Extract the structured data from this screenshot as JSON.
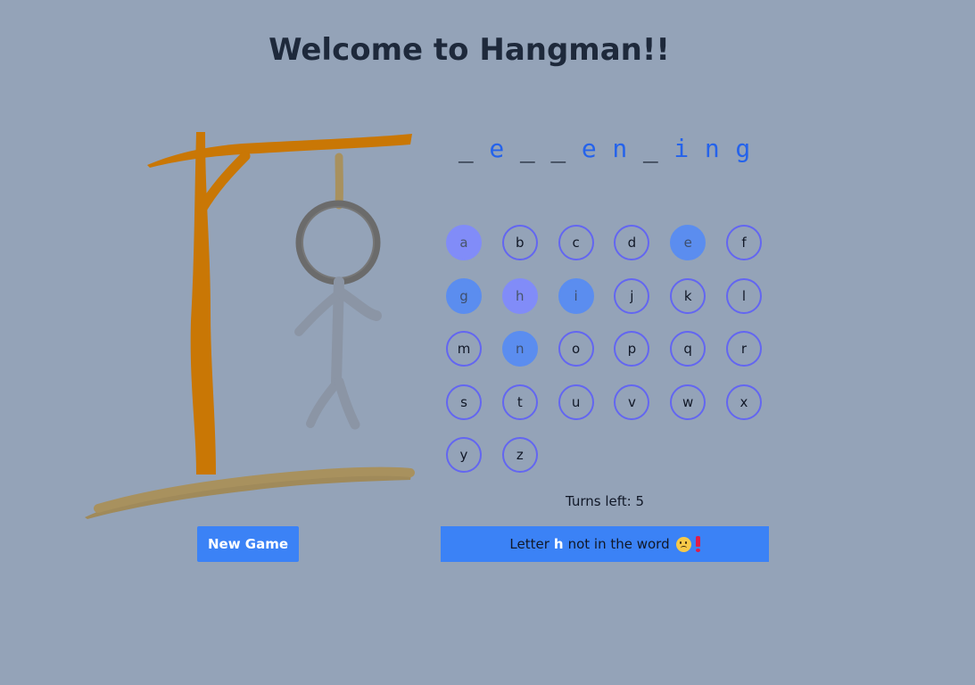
{
  "title": "Welcome to Hangman!!",
  "word": [
    "_",
    "e",
    "_",
    "_",
    "e",
    "n",
    "_",
    "i",
    "n",
    "g"
  ],
  "letters": [
    "a",
    "b",
    "c",
    "d",
    "e",
    "f",
    "g",
    "h",
    "i",
    "j",
    "k",
    "l",
    "m",
    "n",
    "o",
    "p",
    "q",
    "r",
    "s",
    "t",
    "u",
    "v",
    "w",
    "x",
    "y",
    "z"
  ],
  "guessed_wrong": [
    "a",
    "h"
  ],
  "guessed_right": [
    "e",
    "g",
    "i",
    "n"
  ],
  "turns_label": "Turns left: 5",
  "new_game_label": "New Game",
  "message": {
    "prefix": "Letter",
    "letter": "h",
    "suffix": "not in the word",
    "icons": [
      "sad-face-icon",
      "exclamation-icon"
    ]
  },
  "colors": {
    "background": "#94a3b8",
    "accent": "#3b82f6",
    "key_border": "#6366f1",
    "key_wrong": "#818cf8",
    "key_right": "#5b8def",
    "revealed_letter": "#2563eb"
  },
  "hangman_parts_drawn": [
    "base",
    "pole",
    "beam",
    "brace",
    "rope",
    "head",
    "body",
    "left-arm",
    "right-arm",
    "left-leg",
    "right-leg"
  ]
}
